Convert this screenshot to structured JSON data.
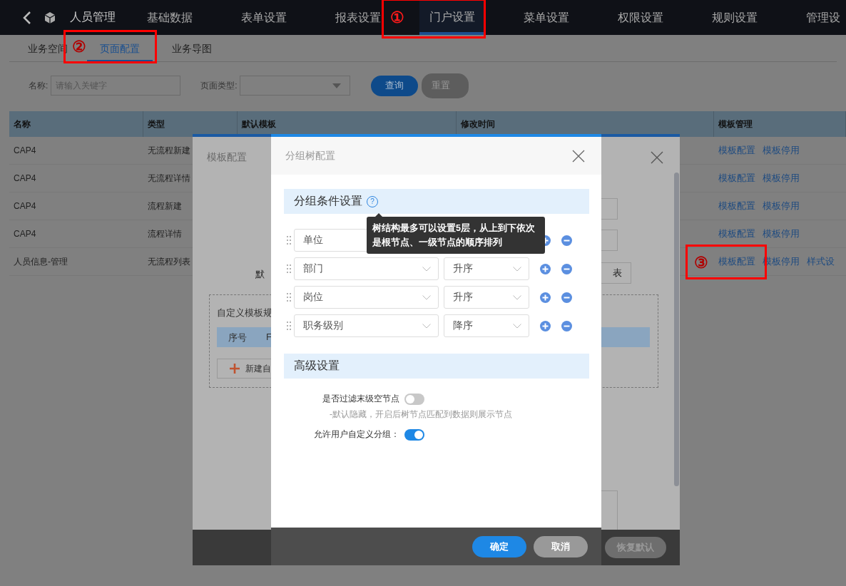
{
  "nav": {
    "app_title": "人员管理",
    "items": [
      {
        "label": "基础数据",
        "selected": false
      },
      {
        "label": "表单设置",
        "selected": false
      },
      {
        "label": "报表设置",
        "selected": false
      },
      {
        "label": "门户设置",
        "selected": true
      },
      {
        "label": "菜单设置",
        "selected": false
      },
      {
        "label": "权限设置",
        "selected": false
      },
      {
        "label": "规则设置",
        "selected": false
      },
      {
        "label": "管理设",
        "selected": false
      }
    ]
  },
  "sub_tabs": [
    {
      "label": "业务空间",
      "selected": false
    },
    {
      "label": "页面配置",
      "selected": true
    },
    {
      "label": "业务导图",
      "selected": false
    }
  ],
  "filters": {
    "name": {
      "label": "名称:",
      "placeholder": "请输入关键字"
    },
    "page_type": {
      "label": "页面类型:"
    },
    "buttons": [
      {
        "label": "查询",
        "kind": "primary"
      },
      {
        "label": "重置",
        "kind": "secondary"
      }
    ]
  },
  "table": {
    "columns": [
      "名称",
      "类型",
      "默认模板",
      "修改时间",
      "模板管理"
    ],
    "rows": [
      {
        "name": "CAP4",
        "type": "无流程新建",
        "actions": [
          "模板配置",
          "模板停用"
        ]
      },
      {
        "name": "CAP4",
        "type": "无流程详情",
        "actions": [
          "模板配置",
          "模板停用"
        ]
      },
      {
        "name": "CAP4",
        "type": "流程新建",
        "actions": [
          "模板配置",
          "模板停用"
        ]
      },
      {
        "name": "CAP4",
        "type": "流程详情",
        "actions": [
          "模板配置",
          "模板停用"
        ]
      },
      {
        "name": "人员信息-管理",
        "type": "无流程列表",
        "actions": [
          "模板配置",
          "模板停用",
          "样式设"
        ]
      }
    ]
  },
  "template_dialog": {
    "title": "模板配置",
    "default_label": "默",
    "type_button": "表",
    "custom_section": "自定义模板规",
    "columns": [
      "序号",
      "F"
    ],
    "new_button": "新建自",
    "reset_button": "恢复默认"
  },
  "group_tree_dialog": {
    "title": "分组树配置",
    "condition_section": "分组条件设置",
    "help_icon": "?",
    "tooltip": "树结构最多可以设置5层，从上到下依次是根节点、一级节点的顺序排列",
    "conditions": [
      {
        "field": "单位"
      },
      {
        "field": "部门",
        "order": "升序"
      },
      {
        "field": "岗位",
        "order": "升序"
      },
      {
        "field": "职务级别",
        "order": "降序"
      }
    ],
    "advanced_section": "高级设置",
    "options": [
      {
        "label": "是否过滤末级空节点",
        "on": false,
        "hint": "-默认隐藏，开启后树节点匹配到数据则展示节点"
      },
      {
        "label": "允许用户自定义分组：",
        "on": true
      }
    ],
    "buttons": [
      {
        "label": "确定",
        "kind": "primary"
      },
      {
        "label": "取消",
        "kind": "secondary"
      }
    ]
  },
  "annotations": [
    "①",
    "②",
    "③"
  ]
}
